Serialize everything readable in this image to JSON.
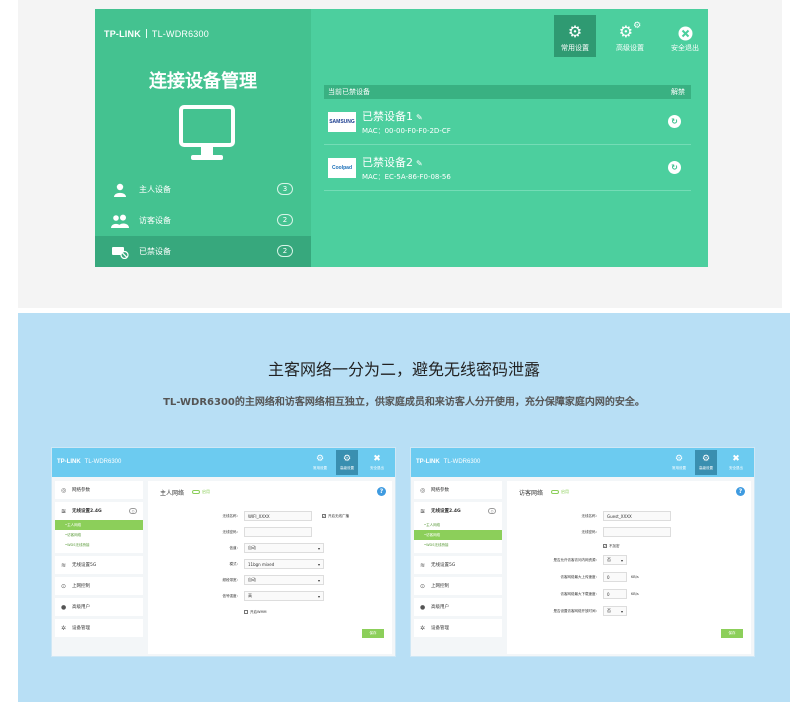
{
  "colors": {
    "primary_green": "#4ccf9e",
    "sidebar_green": "#44c290",
    "light_blue": "#b8dff5",
    "bar_blue": "#6ccbf0",
    "accent_green": "#8ccf5a"
  },
  "top_app": {
    "brand": "TP-LINK",
    "model": "TL-WDR6300",
    "title": "连接设备管理",
    "menu": [
      {
        "label": "主人设备",
        "count": "3",
        "icon": "user-icon"
      },
      {
        "label": "访客设备",
        "count": "2",
        "icon": "guests-icon"
      },
      {
        "label": "已禁设备",
        "count": "2",
        "icon": "blocked-device-icon"
      }
    ],
    "toolbar": [
      {
        "label": "常用设置",
        "icon": "gear-icon"
      },
      {
        "label": "高级设置",
        "icon": "gears-icon"
      },
      {
        "label": "安全退出",
        "icon": "close-icon"
      }
    ],
    "list": {
      "header": "当前已禁设备",
      "action_header": "解禁",
      "devices": [
        {
          "name": "已禁设备1",
          "mac": "MAC：00-00-F0-F0-2D-CF",
          "logo": "SAMSUNG"
        },
        {
          "name": "已禁设备2",
          "mac": "MAC：EC-5A-86-F0-08-56",
          "logo": "Coolpad"
        }
      ]
    }
  },
  "marketing": {
    "headline": "主客网络一分为二，避免无线密码泄露",
    "subline": "TL-WDR6300的主网络和访客网络相互独立，供家庭成员和来访客人分开使用，充分保障家庭内网的安全。"
  },
  "shots": [
    {
      "brand": "TP-LINK",
      "model": "TL-WDR6300",
      "toolbar": [
        "常用设置",
        "高级设置",
        "安全退出"
      ],
      "sidebar": {
        "network": "网络参数",
        "wireless24": "无线设置2.4G",
        "subs": [
          "主人网络",
          "访客网络",
          "WDS无线桥接"
        ],
        "wireless5": "无线设置5G",
        "control": "上网控制",
        "hosts": "高级用户",
        "management": "设备管理"
      },
      "panel": {
        "title": "主人网络",
        "tag": "启用",
        "ssid_label": "无线名称：",
        "ssid": "WIFI_XXXX",
        "broadcast": "开启无线广播",
        "password_label": "无线密码：",
        "channel_label": "信道：",
        "channel": "自动",
        "mode_label": "模式：",
        "mode": "11bgn mixed",
        "bandwidth_label": "频段带宽：",
        "bandwidth": "自动",
        "power_label": "信号强度：",
        "power": "高",
        "wmm": "开启WMM",
        "save": "保存"
      }
    },
    {
      "brand": "TP-LINK",
      "model": "TL-WDR6300",
      "toolbar": [
        "常用设置",
        "高级设置",
        "安全退出"
      ],
      "sidebar": {
        "network": "网络参数",
        "wireless24": "无线设置2.4G",
        "subs": [
          "主人网络",
          "访客网络",
          "WDS无线桥接"
        ],
        "wireless5": "无线设置5G",
        "control": "上网控制",
        "hosts": "高级用户",
        "management": "设备管理"
      },
      "panel": {
        "title": "访客网络",
        "tag": "启用",
        "ssid_label": "无线名称：",
        "ssid": "Guest_XXXX",
        "password_label": "无线密码：",
        "encrypt": "不加密",
        "intranet_label": "是否允许访客访问内网资源：",
        "intranet": "否",
        "upload_label": "访客网络最大上传速度：",
        "upload": "0",
        "download_label": "访客网络最大下载速度：",
        "download": "0",
        "unit": "KB/s",
        "timeout_label": "是否设置访客网络开放时间：",
        "timeout": "否",
        "save": "保存"
      }
    }
  ]
}
